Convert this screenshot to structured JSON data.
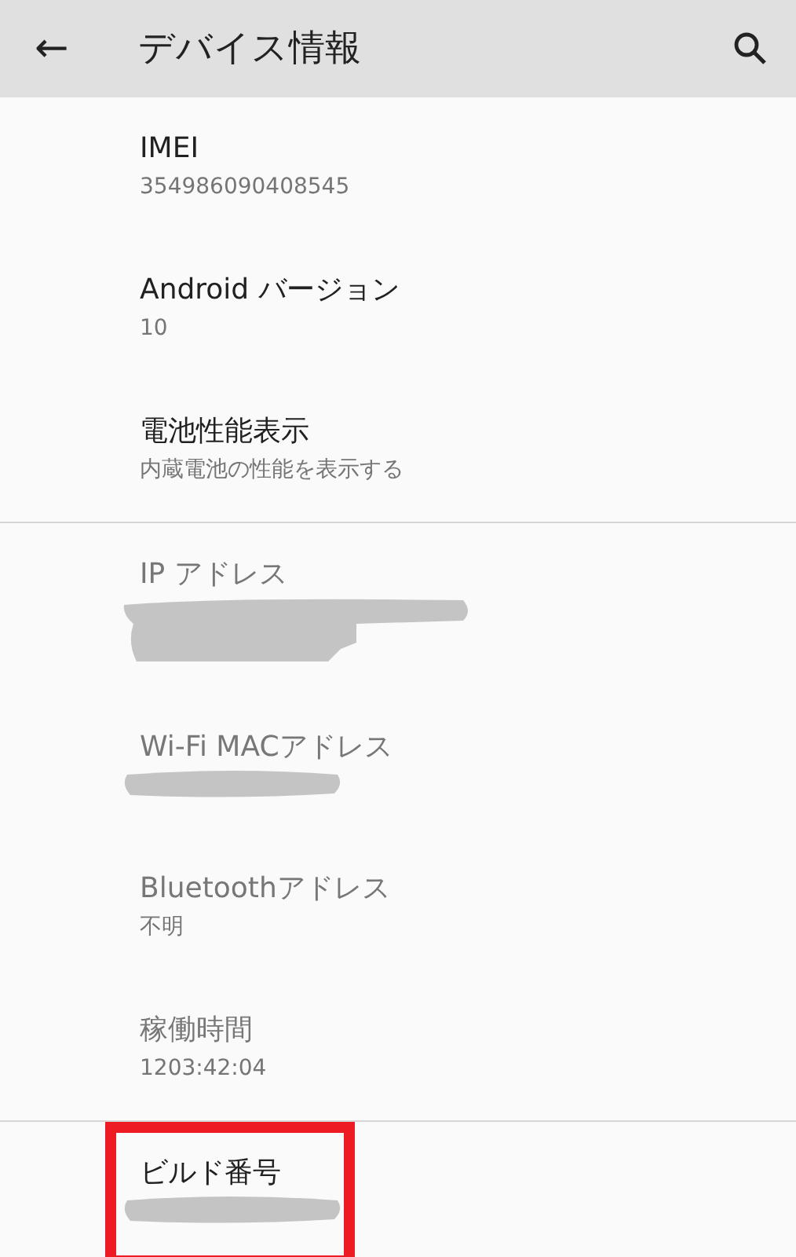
{
  "app_bar": {
    "back_icon": "←",
    "title": "デバイス情報"
  },
  "sections": [
    {
      "items": [
        {
          "title": "IMEI",
          "kind": "text",
          "value": "354986090408545",
          "disabled": false,
          "highlighted": false
        },
        {
          "title": "Android バージョン",
          "kind": "text",
          "value": "10",
          "disabled": false,
          "highlighted": false
        },
        {
          "title": "電池性能表示",
          "kind": "text",
          "value": "内蔵電池の性能を表示する",
          "disabled": false,
          "highlighted": false
        }
      ]
    },
    {
      "items": [
        {
          "title": "IP アドレス",
          "kind": "scribble-block",
          "disabled": true,
          "highlighted": false
        },
        {
          "title": "Wi-Fi MACアドレス",
          "kind": "scribble-line",
          "disabled": true,
          "highlighted": false
        },
        {
          "title": "Bluetoothアドレス",
          "kind": "text",
          "value": "不明",
          "disabled": true,
          "highlighted": false
        },
        {
          "title": "稼働時間",
          "kind": "text",
          "value": "1203:42:04",
          "disabled": true,
          "highlighted": false
        }
      ]
    },
    {
      "items": [
        {
          "title": "ビルド番号",
          "kind": "scribble-line",
          "disabled": false,
          "highlighted": true
        }
      ]
    }
  ]
}
